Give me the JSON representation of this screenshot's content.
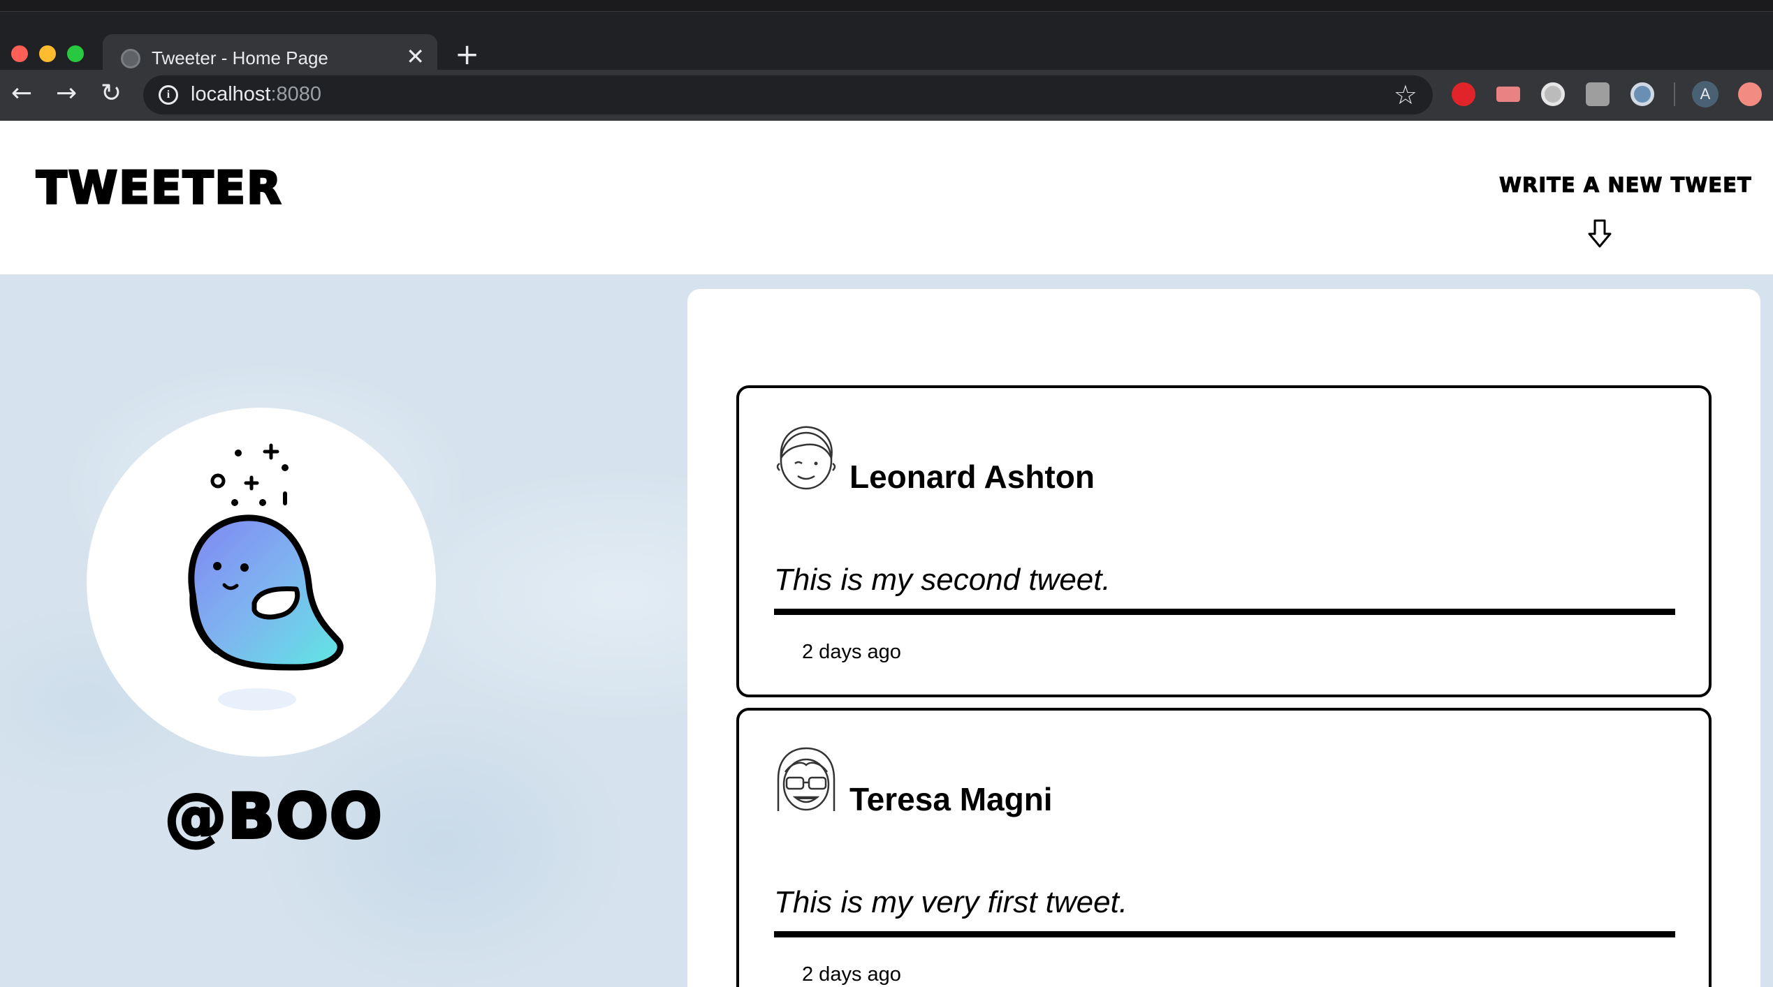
{
  "browser": {
    "tab_title": "Tweeter - Home Page",
    "tab_close": "✕",
    "new_tab": "+",
    "url_host": "localhost",
    "url_port": ":8080",
    "account_initial": "A"
  },
  "navbar": {
    "brand": "TWEETER",
    "compose_label": "WRITE A NEW TWEET"
  },
  "profile": {
    "handle": "@BOO"
  },
  "tweets": [
    {
      "user": "Leonard Ashton",
      "content": "This is my second tweet.",
      "time": "2 days ago"
    },
    {
      "user": "Teresa Magni",
      "content": "This is my very first tweet.",
      "time": "2 days ago"
    }
  ]
}
